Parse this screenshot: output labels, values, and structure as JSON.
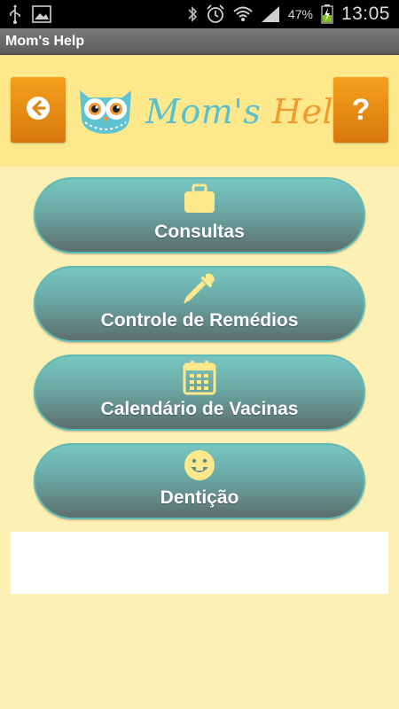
{
  "status_bar": {
    "battery_percent": "47%",
    "time": "13:05",
    "icons_left": [
      "usb-icon",
      "image-icon"
    ],
    "icons_right": [
      "bluetooth-icon",
      "alarm-icon",
      "wifi-icon",
      "signal-icon",
      "battery-charging-icon"
    ]
  },
  "app": {
    "title": "Mom's Help"
  },
  "header": {
    "logo_mom": "Mom's",
    "logo_help": "Help",
    "help_label": "?",
    "colors": {
      "back_button": "#f29a1a",
      "help_button": "#f29a1a",
      "band": "#fde98b"
    }
  },
  "menu": {
    "items": [
      {
        "label": "Consultas",
        "icon": "briefcase-icon"
      },
      {
        "label": "Controle de Remédios",
        "icon": "dropper-icon"
      },
      {
        "label": "Calendário de Vacinas",
        "icon": "calendar-icon"
      },
      {
        "label": "Dentição",
        "icon": "smile-tooth-icon"
      }
    ],
    "colors": {
      "button_top": "#78c6c1",
      "button_bottom": "#5c6e6c",
      "icon": "#fde98b"
    }
  }
}
